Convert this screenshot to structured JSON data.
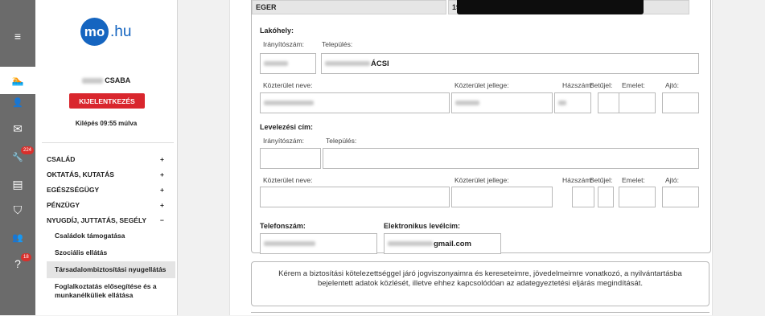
{
  "rail": {
    "items": [
      {
        "icon": "hamburger-icon",
        "glyph": "≡"
      },
      {
        "icon": "swimmer-icon",
        "glyph": "🏊"
      },
      {
        "icon": "user-icon",
        "glyph": "👤"
      },
      {
        "icon": "mail-icon",
        "glyph": "✉"
      },
      {
        "icon": "wrench-icon",
        "glyph": "🔧",
        "badge": "224"
      },
      {
        "icon": "id-card-icon",
        "glyph": "▤"
      },
      {
        "icon": "shield-icon",
        "glyph": "⛉"
      },
      {
        "icon": "add-user-icon",
        "glyph": "👥"
      },
      {
        "icon": "help-icon",
        "glyph": "?",
        "badge": "18"
      }
    ]
  },
  "sidebar": {
    "logo": {
      "circle": "mo",
      "text": ".hu"
    },
    "user_name": "CSABA",
    "logout_label": "KIJELENTKEZÉS",
    "countdown": "Kilépés 09:55 múlva",
    "menu": [
      {
        "label": "CSALÁD",
        "toggle": "+"
      },
      {
        "label": "OKTATÁS, KUTATÁS",
        "toggle": "+"
      },
      {
        "label": "EGÉSZSÉGÜGY",
        "toggle": "+"
      },
      {
        "label": "PÉNZÜGY",
        "toggle": "+"
      },
      {
        "label": "NYUGDÍJ, JUTTATÁS, SEGÉLY",
        "toggle": "−"
      }
    ],
    "submenu": [
      "Családok támogatása",
      "Szociális ellátás",
      "Társadalombiztosítási nyugellátás",
      "Foglalkoztatás elősegítése és a munkanélküliek ellátása"
    ]
  },
  "form": {
    "top_row": {
      "left": "EGER",
      "right": "1977.0"
    },
    "residence": {
      "title": "Lakóhely:",
      "zip_label": "Irányítószám:",
      "city_label": "Település:",
      "city_value": "ÁCSI",
      "street_label": "Közterület neve:",
      "street_type_label": "Közterület jellege:",
      "house_label": "Házszám:",
      "letter_label": "Betűjel:",
      "floor_label": "Emelet:",
      "door_label": "Ajtó:"
    },
    "mailing": {
      "title": "Levelezési cím:",
      "zip_label": "Irányítószám:",
      "city_label": "Település:",
      "street_label": "Közterület neve:",
      "street_type_label": "Közterület jellege:",
      "house_label": "Házszám:",
      "letter_label": "Betűjel:",
      "floor_label": "Emelet:",
      "door_label": "Ajtó:"
    },
    "phone_label": "Telefonszám:",
    "email_label": "Elektronikus levélcím:",
    "email_value": "gmail.com",
    "consent_text": "Kérem a biztosítási kötelezettséggel járó jogviszonyaimra és kereseteimre, jövedelmeimre vonatkozó, a nyilvántartásba bejelentett adatok közlését, illetve ehhez kapcsolódóan az adategyeztetési eljárás megindítását."
  }
}
